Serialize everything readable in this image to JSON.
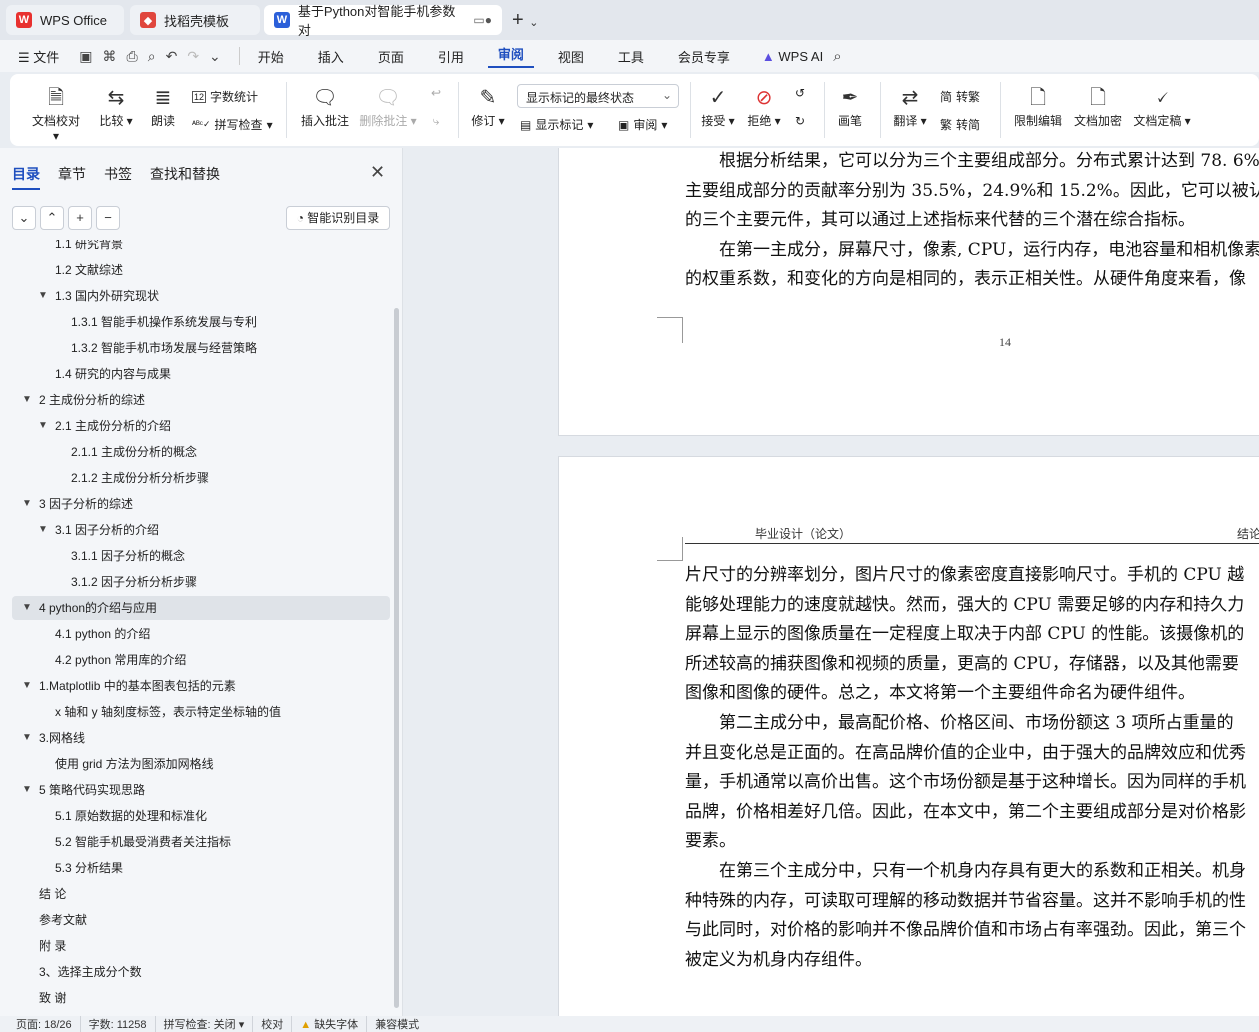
{
  "tabs": {
    "t1": "WPS Office",
    "t2": "找稻壳模板",
    "t3": "基于Python对智能手机参数对"
  },
  "menu": {
    "file": "文件",
    "items": [
      "开始",
      "插入",
      "页面",
      "引用",
      "审阅",
      "视图",
      "工具",
      "会员专享"
    ],
    "wps_ai": "WPS AI"
  },
  "ribbon": {
    "doc_check": "文档校对",
    "compare": "比较",
    "read_aloud": "朗读",
    "word_count": "字数统计",
    "spell_check": "拼写检查",
    "insert_comment": "插入批注",
    "delete_comment": "删除批注",
    "revise": "修订",
    "markup_state": "显示标记的最终状态",
    "show_markup": "显示标记",
    "review": "审阅",
    "accept": "接受",
    "reject": "拒绝",
    "pen": "画笔",
    "translate": "翻译",
    "to_trad": "转繁",
    "to_simp": "转简",
    "restrict": "限制编辑",
    "encrypt": "文档加密",
    "finalize": "文档定稿"
  },
  "panel": {
    "tabs": [
      "目录",
      "章节",
      "书签",
      "查找和替换"
    ],
    "smart_toc": "智能识别目录",
    "toc": [
      {
        "label": "1.1 研究背景",
        "level": 2
      },
      {
        "label": "1.2 文献综述",
        "level": 2
      },
      {
        "label": "1.3 国内外研究现状",
        "level": 2,
        "expanded": true
      },
      {
        "label": "1.3.1 智能手机操作系统发展与专利",
        "level": 3
      },
      {
        "label": "1.3.2 智能手机市场发展与经营策略",
        "level": 3
      },
      {
        "label": "1.4  研究的内容与成果",
        "level": 2
      },
      {
        "label": "2 主成份分析的综述",
        "level": 1,
        "expanded": true
      },
      {
        "label": "2.1 主成份分析的介绍",
        "level": 2,
        "expanded": true
      },
      {
        "label": "2.1.1 主成份分析的概念",
        "level": 3
      },
      {
        "label": "2.1.2 主成份分析分析步骤",
        "level": 3
      },
      {
        "label": "3  因子分析的综述",
        "level": 1,
        "expanded": true
      },
      {
        "label": "3.1  因子分析的介绍",
        "level": 2,
        "expanded": true
      },
      {
        "label": "3.1.1  因子分析的概念",
        "level": 3
      },
      {
        "label": "3.1.2 因子分析分析步骤",
        "level": 3
      },
      {
        "label": "4 python的介绍与应用",
        "level": 1,
        "expanded": true,
        "selected": true
      },
      {
        "label": "4.1 python 的介绍",
        "level": 2
      },
      {
        "label": "4.2 python 常用库的介绍",
        "level": 2
      },
      {
        "label": "1.Matplotlib 中的基本图表包括的元素",
        "level": 1,
        "expanded": true
      },
      {
        "label": "x 轴和 y 轴刻度标签，表示特定坐标轴的值",
        "level": 2
      },
      {
        "label": "3.网格线",
        "level": 1,
        "expanded": true
      },
      {
        "label": "使用 grid 方法为图添加网格线",
        "level": 2
      },
      {
        "label": "5 策略代码实现思路",
        "level": 1,
        "expanded": true
      },
      {
        "label": "5.1  原始数据的处理和标准化",
        "level": 2
      },
      {
        "label": "5.2  智能手机最受消费者关注指标",
        "level": 2
      },
      {
        "label": "5.3  分析结果",
        "level": 2
      },
      {
        "label": "结  论",
        "level": 1
      },
      {
        "label": "参考文献",
        "level": 1
      },
      {
        "label": "附  录",
        "level": 1
      },
      {
        "label": "3、选择主成分个数",
        "level": 1
      },
      {
        "label": "致  谢",
        "level": 1
      }
    ]
  },
  "doc": {
    "page1_lines": [
      "　　根据分析结果，它可以分为三个主要组成部分。分布式累计达到 78. 6%",
      "主要组成部分的贡献率分别为 35.5%，24.9%和 15.2%。因此，它可以被认",
      "的三个主要元件，其可以通过上述指标来代替的三个潜在综合指标。",
      "　　在第一主成分，屏幕尺寸，像素, CPU，运行内存，电池容量和相机像素",
      "的权重系数，和变化的方向是相同的，表示正相关性。从硬件角度来看，像"
    ],
    "page_number": "14",
    "header_left": "毕业设计（论文）",
    "header_right": "结论",
    "page2_lines": [
      "片尺寸的分辨率划分，图片尺寸的像素密度直接影响尺寸。手机的 CPU 越",
      "能够处理能力的速度就越快。然而，强大的 CPU 需要足够的内存和持久力",
      "屏幕上显示的图像质量在一定程度上取决于内部 CPU 的性能。该摄像机的",
      "所述较高的捕获图像和视频的质量，更高的 CPU，存储器，以及其他需要",
      "图像和图像的硬件。总之，本文将第一个主要组件命名为硬件组件。",
      "　　第二主成分中，最高配价格、价格区间、市场份额这 3 项所占重量的",
      "并且变化总是正面的。在高品牌价值的企业中，由于强大的品牌效应和优秀",
      "量，手机通常以高价出售。这个市场份额是基于这种增长。因为同样的手机",
      "品牌，价格相差好几倍。因此，在本文中，第二个主要组成部分是对价格影",
      "要素。",
      "　　在第三个主成分中，只有一个机身内存具有更大的系数和正相关。机身",
      "种特殊的内存，可读取可理解的移动数据并节省容量。这并不影响手机的性",
      "与此同时，对价格的影响并不像品牌价值和市场占有率强劲。因此，第三个",
      "被定义为机身内存组件。"
    ]
  },
  "status": {
    "page": "页面: 18/26",
    "words": "字数: 11258",
    "spell": "拼写检查: 关闭",
    "proof": "校对",
    "missing_font": "缺失字体",
    "compat": "兼容模式"
  },
  "colors": {
    "accent": "#1f4fbf",
    "wps_red": "#e8312f"
  }
}
